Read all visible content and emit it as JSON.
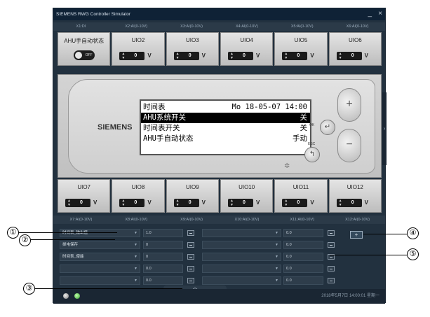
{
  "window": {
    "title": "SIEMENS RWG Controller Simulator",
    "minimize": "_",
    "close": "×"
  },
  "top_io_headers": [
    "X1:DI",
    "X2:AI(0-10V)",
    "X3:AI(0-10V)",
    "X4:AI(0-10V)",
    "X5:AI(0-10V)",
    "X6:AI(0-10V)"
  ],
  "top_io": [
    {
      "label": "AHU手自动状态",
      "toggle": "OFF"
    },
    {
      "label": "UIO2",
      "value": "0",
      "unit": "V"
    },
    {
      "label": "UIO3",
      "value": "0",
      "unit": "V"
    },
    {
      "label": "UIO4",
      "value": "0",
      "unit": "V"
    },
    {
      "label": "UIO5",
      "value": "0",
      "unit": "V"
    },
    {
      "label": "UIO6",
      "value": "0",
      "unit": "V"
    }
  ],
  "device": {
    "brand": "SIEMENS",
    "lcd": [
      {
        "left": "时间表",
        "right": "Mo 18-05-07 14:00"
      },
      {
        "left": "AHU系统开关",
        "right": "关"
      },
      {
        "left": "时间表开关",
        "right": "关"
      },
      {
        "left": "AHU手自动状态",
        "right": "手动"
      }
    ],
    "ok_label": "OK",
    "esc_label": "ESC",
    "plus": "+",
    "minus": "−"
  },
  "bottom_io": [
    {
      "label": "UIO7",
      "value": "0",
      "unit": "V"
    },
    {
      "label": "UIO8",
      "value": "0",
      "unit": "V"
    },
    {
      "label": "UIO9",
      "value": "0",
      "unit": "V"
    },
    {
      "label": "UIO10",
      "value": "0",
      "unit": "V"
    },
    {
      "label": "UIO11",
      "value": "0",
      "unit": "V"
    },
    {
      "label": "UIO12",
      "value": "0",
      "unit": "V"
    }
  ],
  "bottom_io_headers": [
    "X7:AI(0-10V)",
    "X8:AI(0-10V)",
    "X9:AI(0-10V)",
    "X10:AI(0-10V)",
    "X11:AI(0-10V)",
    "X12:AI(0-10V)"
  ],
  "mapping_rows": [
    {
      "left_select": "时间表_输出值",
      "left_value": "1.0",
      "right_select": "",
      "right_value": "0.0"
    },
    {
      "left_select": "掉电保存",
      "left_value": "0",
      "right_select": "",
      "right_value": "0.0"
    },
    {
      "left_select": "时间表_使能",
      "left_value": "0",
      "right_select": "",
      "right_value": "0.0"
    },
    {
      "left_select": "",
      "left_value": "0.0",
      "right_select": "",
      "right_value": "0.0"
    },
    {
      "left_select": "",
      "left_value": "0.0",
      "right_select": "",
      "right_value": "0.0"
    }
  ],
  "add_button": "+",
  "status": {
    "clock": "2018年5月7日 14:00:01 星期一"
  },
  "callouts": [
    "①",
    "②",
    "③",
    "④",
    "⑤"
  ],
  "icons": {
    "stepper": "updown-arrows-icon",
    "enter": "enter-arrow-icon",
    "esc": "back-arrow-icon",
    "gear": "gear-icon",
    "collapse": "chevron-up-icon",
    "side": "chevron-right-icon"
  }
}
